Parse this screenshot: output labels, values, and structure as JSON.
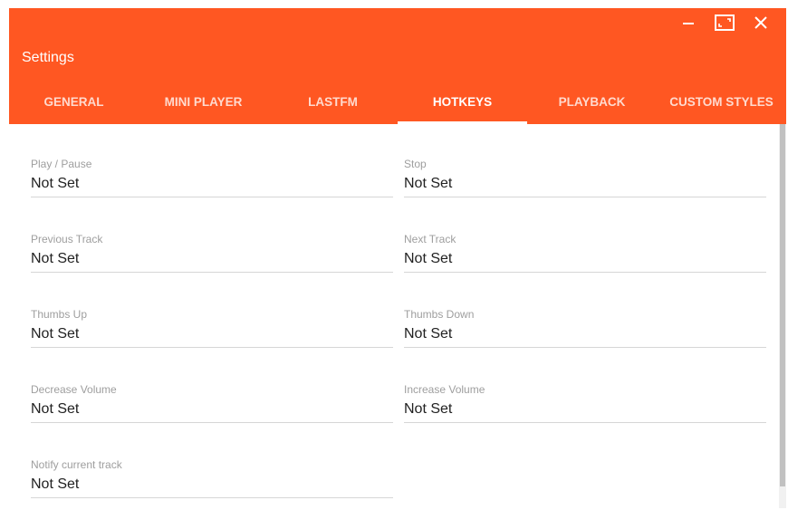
{
  "window": {
    "title": "Settings"
  },
  "tabs": [
    {
      "label": "GENERAL"
    },
    {
      "label": "MINI PLAYER"
    },
    {
      "label": "LASTFM"
    },
    {
      "label": "HOTKEYS"
    },
    {
      "label": "PLAYBACK"
    },
    {
      "label": "CUSTOM STYLES"
    }
  ],
  "active_tab": "HOTKEYS",
  "colors": {
    "accent": "#ff5722"
  },
  "hotkeys": {
    "play_pause": {
      "label": "Play / Pause",
      "value": "Not Set"
    },
    "stop": {
      "label": "Stop",
      "value": "Not Set"
    },
    "previous_track": {
      "label": "Previous Track",
      "value": "Not Set"
    },
    "next_track": {
      "label": "Next Track",
      "value": "Not Set"
    },
    "thumbs_up": {
      "label": "Thumbs Up",
      "value": "Not Set"
    },
    "thumbs_down": {
      "label": "Thumbs Down",
      "value": "Not Set"
    },
    "decrease_volume": {
      "label": "Decrease Volume",
      "value": "Not Set"
    },
    "increase_volume": {
      "label": "Increase Volume",
      "value": "Not Set"
    },
    "notify_current_track": {
      "label": "Notify current track",
      "value": "Not Set"
    }
  }
}
